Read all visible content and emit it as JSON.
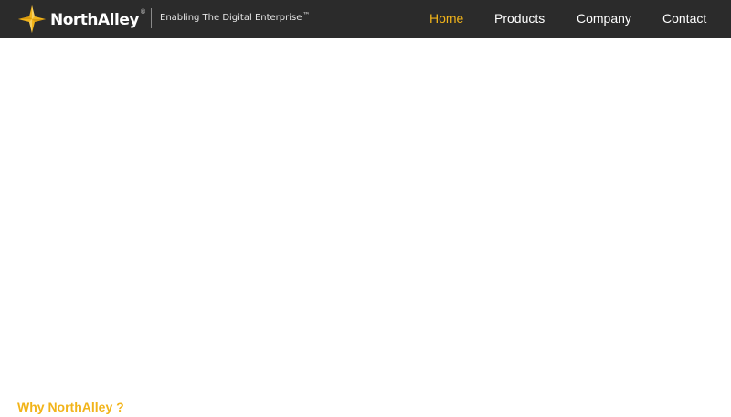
{
  "brand": {
    "name": "NorthAlley",
    "registered_mark": "®",
    "tagline": "Enabling The Digital Enterprise",
    "tagline_mark": "™",
    "accent_color": "#f2b41a",
    "nav_background": "#2b2b2b"
  },
  "nav": {
    "items": [
      {
        "label": "Home",
        "active": true
      },
      {
        "label": "Products",
        "active": false
      },
      {
        "label": "Company",
        "active": false
      },
      {
        "label": "Contact",
        "active": false
      }
    ]
  },
  "main": {
    "section_heading": "Why NorthAlley ?"
  },
  "icons": {
    "logo": "four-point-star-logo-icon"
  }
}
